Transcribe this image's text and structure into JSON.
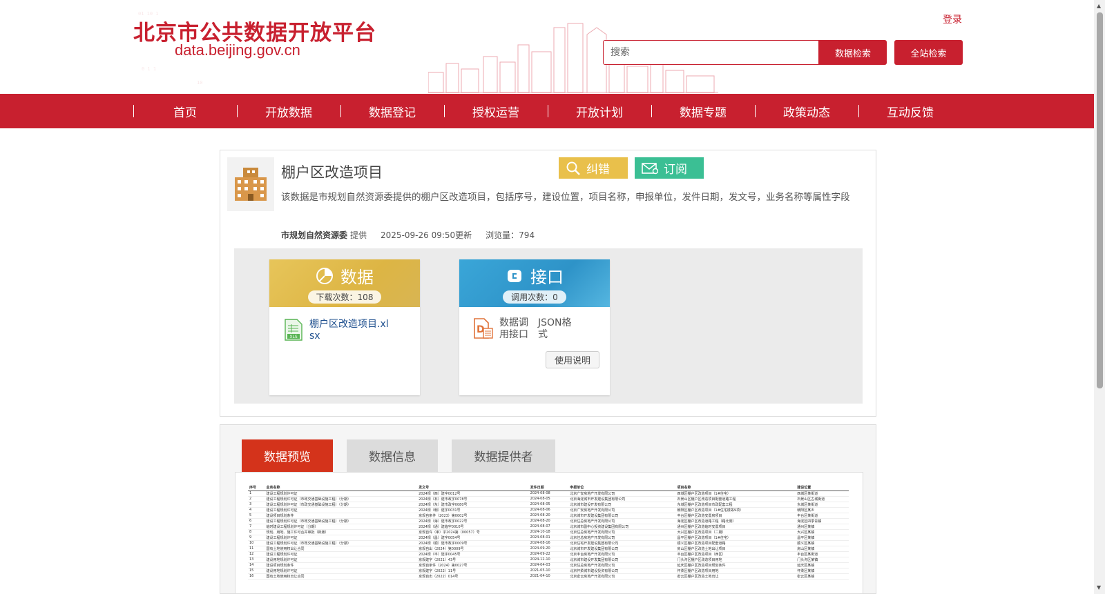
{
  "header": {
    "logo_cn": "北京市公共数据开放平台",
    "logo_en": "data.beijing.gov.cn",
    "login": "登录",
    "search_placeholder": "搜索",
    "data_search": "数据检索",
    "site_search": "全站检索"
  },
  "nav": {
    "items": [
      {
        "label": "首页"
      },
      {
        "label": "开放数据"
      },
      {
        "label": "数据登记"
      },
      {
        "label": "授权运营"
      },
      {
        "label": "开放计划"
      },
      {
        "label": "数据专题"
      },
      {
        "label": "政策动态"
      },
      {
        "label": "互动反馈"
      }
    ]
  },
  "dataset": {
    "title": "棚户区改造项目",
    "correct_label": "纠错",
    "subscribe_label": "订阅",
    "description": "该数据是市规划自然资源委提供的棚户区改造项目，包括序号，建设位置，项目名称，申报单位，发件日期，发文号，业务名称等属性字段",
    "provider": "市规划自然资源委",
    "provider_suffix": "提供",
    "updated": "2025-09-26 09:50更新",
    "views": "浏览量：794"
  },
  "resources": {
    "data": {
      "title": "数据",
      "count": "下载次数：108",
      "file": "棚户区改造项目.xlsx",
      "file_icon": "xls-file-icon",
      "accent": "#ddb544"
    },
    "api": {
      "title": "接口",
      "count": "调用次数：0",
      "type": "数据调用接口",
      "format": "JSON格式",
      "usage": "使用说明",
      "accent": "#2e93c8"
    }
  },
  "tabs": [
    {
      "label": "数据预览",
      "active": true
    },
    {
      "label": "数据信息",
      "active": false
    },
    {
      "label": "数据提供者",
      "active": false
    }
  ],
  "preview": {
    "headers": [
      "序号",
      "业务名称",
      "发文号",
      "发件日期",
      "申报单位",
      "项目名称",
      "建设位置"
    ],
    "rows": [
      [
        "1",
        "建设工程规划许可证",
        "2024规（西）建字0012号",
        "2024-08-08",
        "北京广安房地产开发有限公司",
        "西城区棚户区改造项目（1#住宅）",
        "西城区某街道"
      ],
      [
        "2",
        "建设工程规划许可证（市政交通基础设施工程）（分期）",
        "2024规（石）建市政字0078号",
        "2024-08-05",
        "北京海淀城市开发建设集团有限公司",
        "石景山区棚户区改造项目配套道路工程",
        "石景山区古城街道"
      ],
      [
        "3",
        "建设工程规划许可证（市政交通基础设施工程）（分期）",
        "2024规（东）建市政字0080号",
        "2024-08-05",
        "北京城市建设开发有限公司",
        "东城区棚户区改造项目市政配套工程",
        "东城区某街道"
      ],
      [
        "4",
        "建设工程规划许可证",
        "2024规（朝）建字0031号",
        "2024-08-06",
        "北京广安房地产开发有限公司",
        "朝阳区棚户区改造项目（1#住宅楼等9项）",
        "朝阳区某乡"
      ],
      [
        "5",
        "建设项目规划条件",
        "京规自条件（2023）第0002号",
        "2024-08-20",
        "北京城市开发建设集团有限公司",
        "丰台区棚户区改造安置房项目",
        "丰台区某街道"
      ],
      [
        "6",
        "建设工程规划许可证（市政交通基础设施工程）（分期）",
        "2024规（海）建市政字0022号",
        "2024-08-20",
        "北京住总房地产开发有限公司",
        "海淀区棚户区改造道路工程（路北侧）",
        "海淀区四季青镇"
      ],
      [
        "7",
        "临时建设工程规划许可证（分期）",
        "2024规（通）建临字0010号",
        "2024-08-07",
        "北京城市副中心投资建设集团有限公司",
        "通州区棚户区改造临时安置项目",
        "通州区某镇"
      ],
      [
        "8",
        "规划、用地、施工许可合并审批（新版）",
        "京规自许（审）字2024第（00057）号",
        "2024-10-18",
        "北京住总房地产开发有限公司",
        "大兴区棚户区改造项目（二期）",
        "大兴区某镇"
      ],
      [
        "9",
        "建设工程规划许可证",
        "2024规（昌）建字0054号",
        "2024-08-01",
        "北京住总房地产开发有限公司",
        "昌平区棚户区改造项目（1#住宅）",
        "昌平区某镇"
      ],
      [
        "10",
        "建设工程规划许可证（市政交通基础设施工程）（分期）",
        "2024规（顺）建市政字0009号",
        "2024-08-16",
        "北京住宅开发建设集团有限公司",
        "顺义区棚户区改造项目配套道路",
        "顺义区某镇"
      ],
      [
        "11",
        "国有土地使用权出让合同",
        "京规自出（2024）第0009号",
        "2024-09-20",
        "北京城市开发建设集团有限公司",
        "房山区棚户区改造土地出让项目",
        "房山区某镇"
      ],
      [
        "12",
        "建设工程规划许可证",
        "2024规（丰）建字0045号",
        "2024-09-22",
        "北京丰台房地产开发有限公司",
        "丰台区棚户区改造项目（西区）",
        "丰台区某街道"
      ],
      [
        "13",
        "建设用地规划许可证",
        "京规建字（2021）43号",
        "2024-12-10",
        "北京城市建设开发集团有限公司",
        "门头沟区棚户区改造项目用地",
        "门头沟区某镇"
      ],
      [
        "14",
        "建设项目规划条件",
        "京规自条件（2024）第0027号",
        "2024-04-03",
        "北京住总房地产开发有限公司",
        "延庆区棚户区改造项目规划条件",
        "延庆区某镇"
      ],
      [
        "15",
        "建设用地规划许可证",
        "京规建字（2022）11号",
        "2021-05-10",
        "北京怀柔城市建设投资有限公司",
        "怀柔区棚户区改造项目用地",
        "怀柔区某镇"
      ],
      [
        "16",
        "国有土地使用权出让合同",
        "京规自出（2022）014号",
        "2021-04-10",
        "北京密云房地产开发有限公司",
        "密云区棚户区改造土地出让",
        "密云区某镇"
      ]
    ]
  },
  "colors": {
    "brand_red": "#c8202f",
    "tab_active": "#d4331b",
    "correct_yellow": "#e9c04b",
    "subscribe_green": "#3bbf94"
  }
}
